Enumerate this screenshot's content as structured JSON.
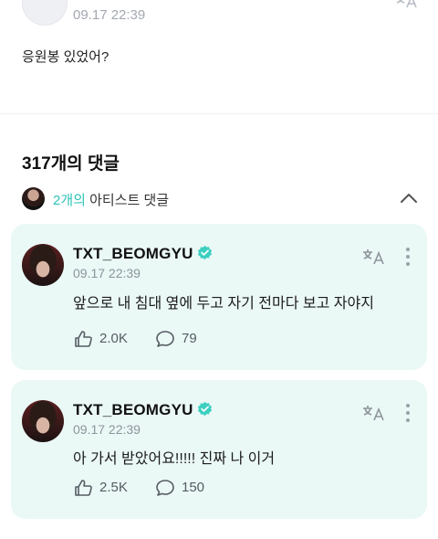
{
  "post": {
    "time": "09.17 22:39",
    "text": "응원봉 있었어?"
  },
  "comments_section": {
    "count_label": "317개의 댓글",
    "artist_count": "2개의",
    "artist_label": " 아티스트 댓글"
  },
  "comments": [
    {
      "author": "TXT_BEOMGYU",
      "time": "09.17 22:39",
      "text": "앞으로 내 침대 옆에 두고 자기 전마다 보고 자야지",
      "likes": "2.0K",
      "replies": "79"
    },
    {
      "author": "TXT_BEOMGYU",
      "time": "09.17 22:39",
      "text": "아 가서 받았어요!!!!! 진짜 나 이거",
      "likes": "2.5K",
      "replies": "150"
    }
  ],
  "colors": {
    "accent": "#2ec4b6",
    "card_bg": "#eaf8f6",
    "verified": "#3ccfc0"
  },
  "icons": [
    "translate-icon",
    "more-icon",
    "chevron-up-icon",
    "verified-badge-icon",
    "like-icon",
    "reply-icon"
  ]
}
